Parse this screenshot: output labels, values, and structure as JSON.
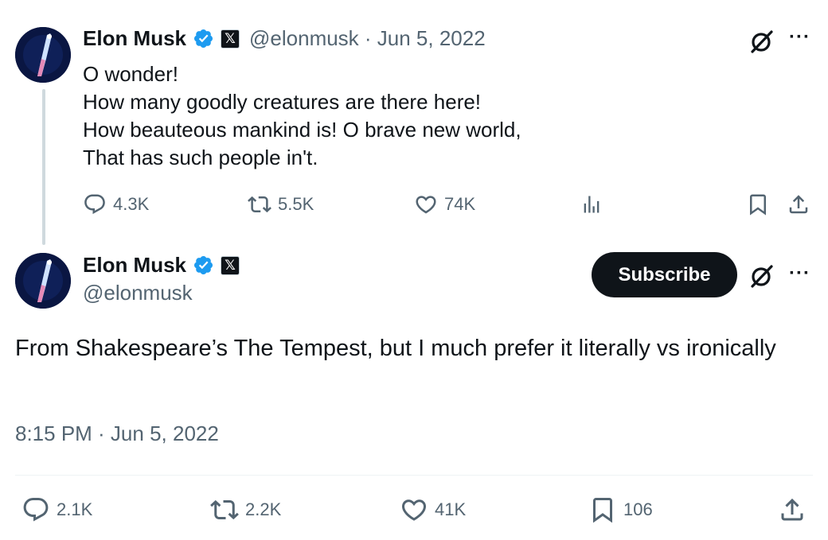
{
  "tweet1": {
    "author_name": "Elon Musk",
    "handle_date": "@elonmusk · Jun 5, 2022",
    "lines": [
      "O wonder!",
      "How many goodly creatures are there here!",
      "How beauteous mankind is! O brave new world,",
      "That has such people in't."
    ],
    "replies": "4.3K",
    "reposts": "5.5K",
    "likes": "74K"
  },
  "tweet2": {
    "author_name": "Elon Musk",
    "handle": "@elonmusk",
    "subscribe_label": "Subscribe",
    "text": "From Shakespeare’s The Tempest, but I much prefer it literally vs ironically",
    "timestamp": "8:15 PM · Jun 5, 2022",
    "replies": "2.1K",
    "reposts": "2.2K",
    "likes": "41K",
    "bookmarks": "106"
  },
  "icons": {
    "verified": "verified-badge-icon",
    "x_logo": "x-logo-icon",
    "grok": "grok-icon",
    "more": "more-icon",
    "reply": "reply-icon",
    "repost": "repost-icon",
    "like": "like-icon",
    "views": "views-icon",
    "bookmark": "bookmark-icon",
    "share": "share-icon"
  },
  "x_badge_glyph": "𝕏",
  "more_glyph": "···",
  "colors": {
    "text_primary": "#0f1419",
    "text_secondary": "#536471",
    "verified_blue": "#1d9bf0",
    "subscribe_bg": "#0f1419"
  }
}
